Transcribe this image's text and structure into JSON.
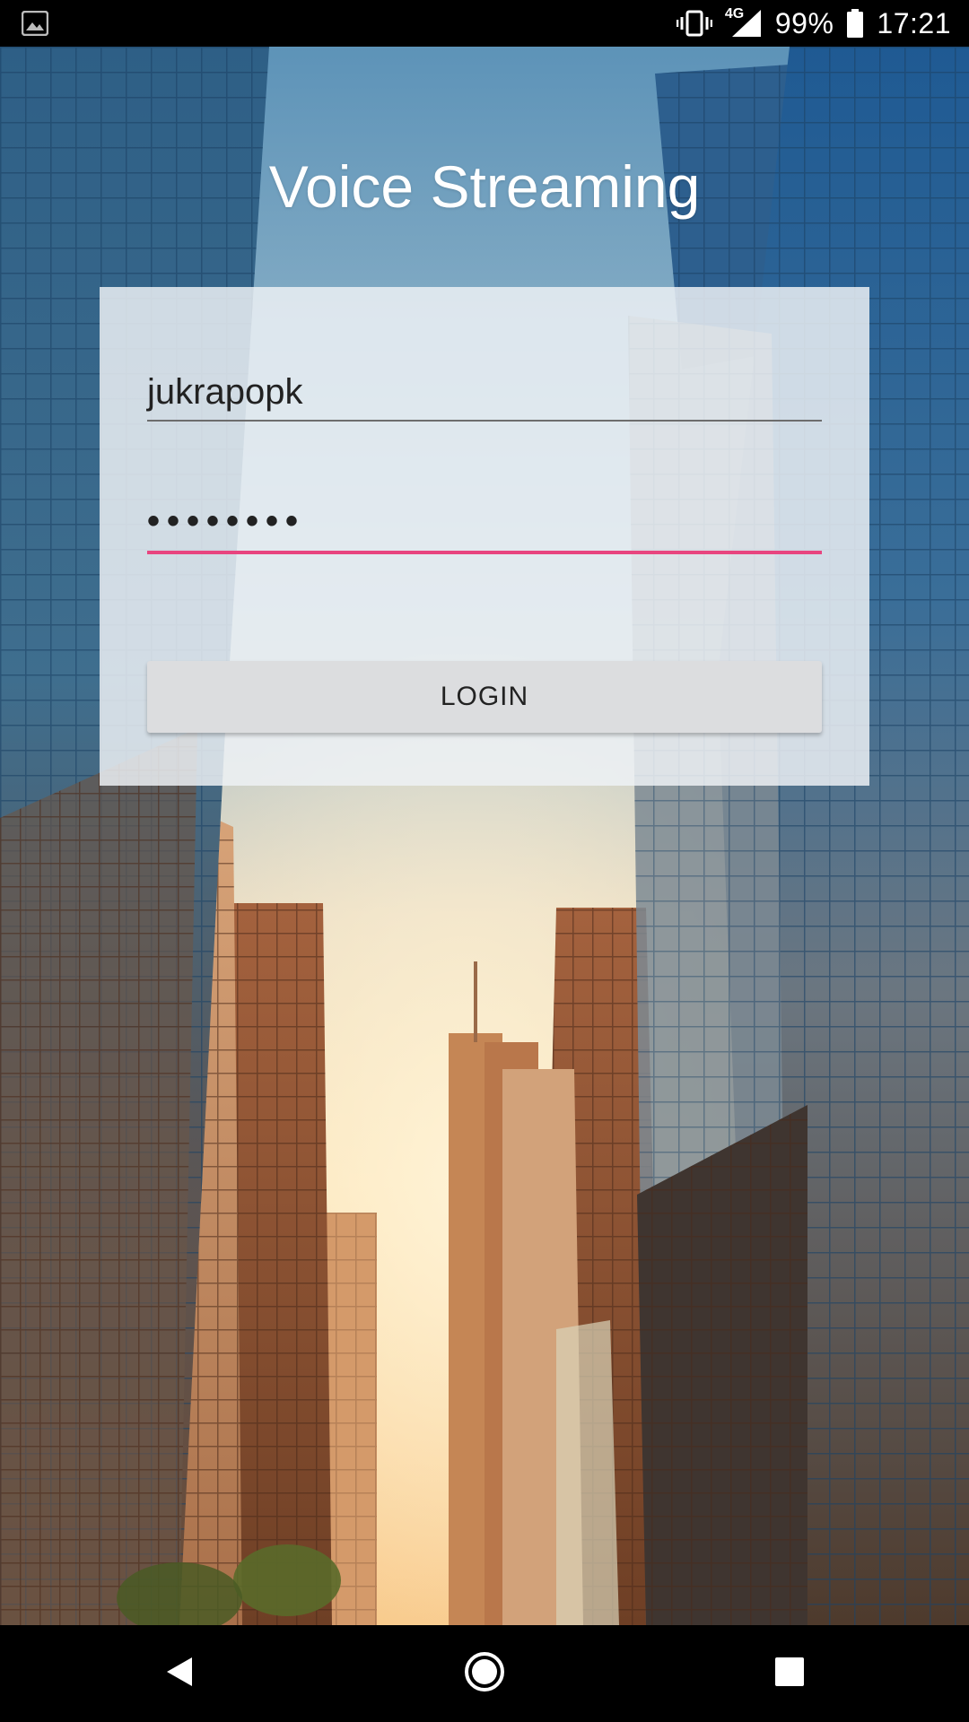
{
  "status_bar": {
    "left_icon": "image-icon",
    "network": "4G",
    "battery_percent": "99%",
    "time": "17:21"
  },
  "app": {
    "title": "Voice Streaming"
  },
  "login_form": {
    "username_value": "jukrapopk",
    "password_masked": "••••••••",
    "login_button_label": "LOGIN",
    "accent_color": "#e8457f"
  },
  "nav_bar": {
    "back_icon": "back-icon",
    "home_icon": "home-icon",
    "recents_icon": "recents-icon"
  }
}
